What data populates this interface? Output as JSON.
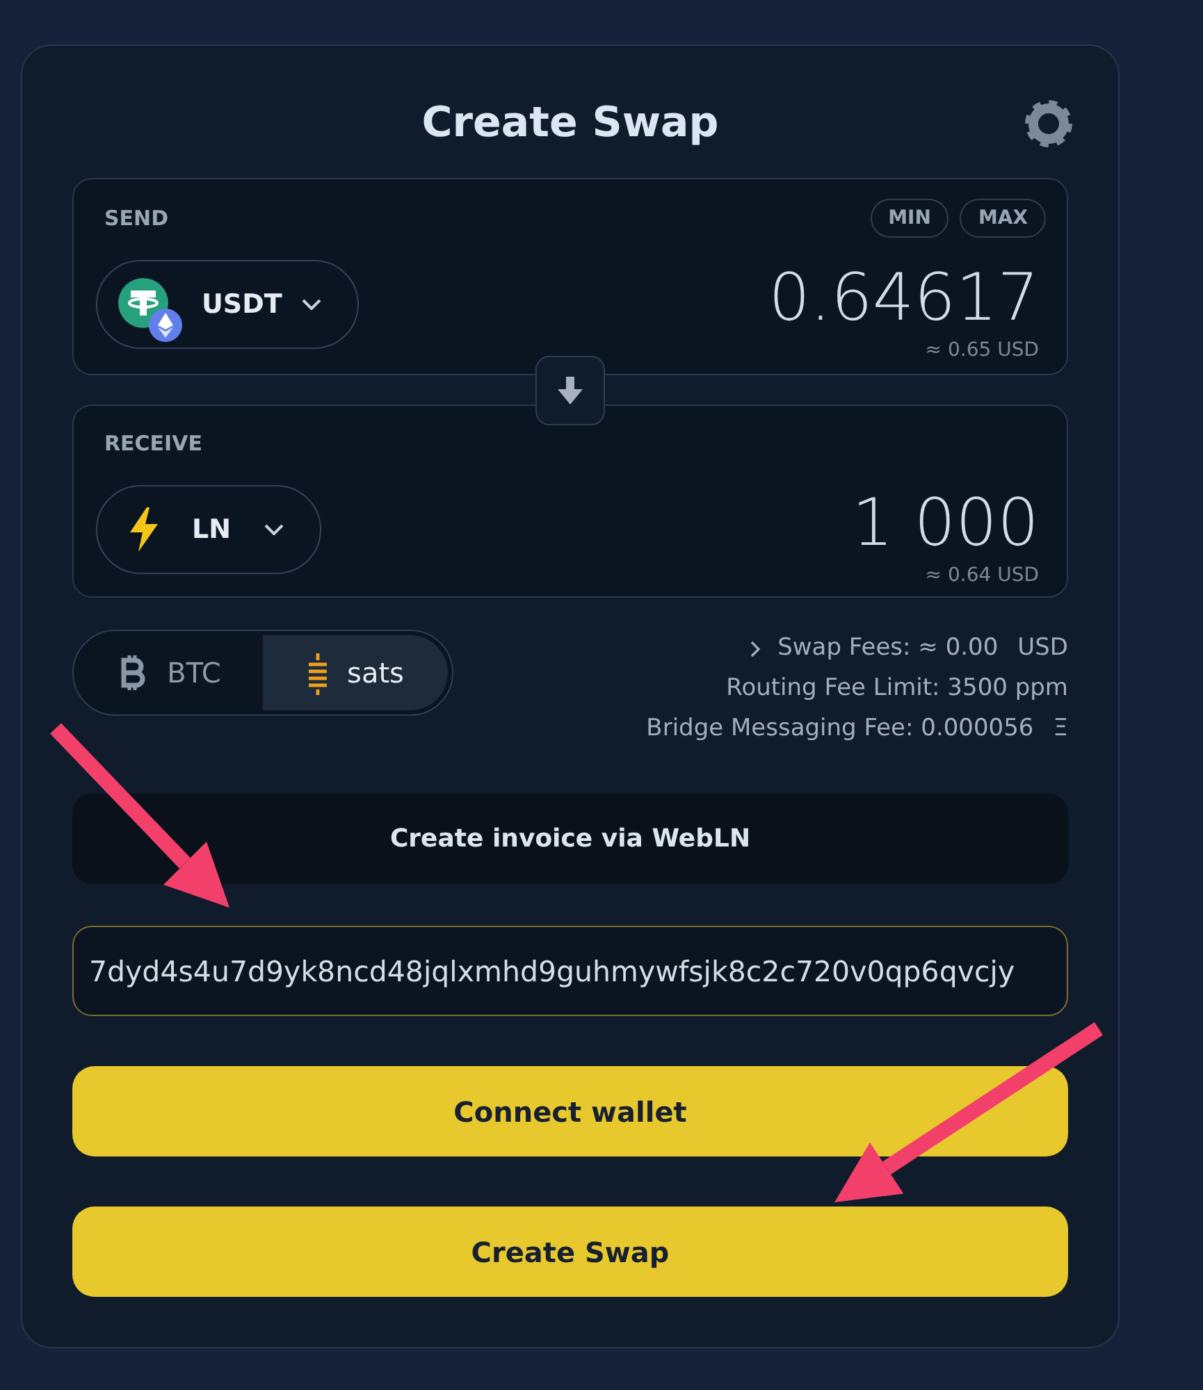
{
  "header": {
    "title": "Create Swap"
  },
  "send": {
    "label": "SEND",
    "quick_buttons": [
      "MIN",
      "MAX"
    ],
    "asset": {
      "kind": "tether",
      "symbol": "USDT",
      "network_badge": true
    },
    "amount": "0.64617",
    "fiat": "≈ 0.65 USD"
  },
  "receive": {
    "label": "RECEIVE",
    "asset": {
      "kind": "lightning",
      "symbol": "LN",
      "network_badge": false
    },
    "amount": "1 000",
    "fiat": "≈ 0.64 USD"
  },
  "denomination": [
    {
      "kind": "btc",
      "label": "BTC",
      "selected": false
    },
    {
      "kind": "sats",
      "label": "sats",
      "selected": true
    }
  ],
  "fees": {
    "expanded": false,
    "lines": [
      {
        "text": "Swap Fees: ≈ 0.00",
        "unit": "USD"
      },
      {
        "text": "Routing Fee Limit: 3500 ppm"
      },
      {
        "text": "Bridge Messaging Fee: 0.000056",
        "unit": "Ξ"
      }
    ]
  },
  "webln_button": "Create invoice via WebLN",
  "invoice": {
    "value": "7dyd4s4u7d9yk8ncd48jqlxmhd9guhmywfsjk8c2c720v0qp6qvcjy"
  },
  "buttons": [
    "Connect wallet",
    "Create Swap"
  ],
  "annotations": [
    {
      "kind": "arrow"
    },
    {
      "kind": "arrow"
    }
  ]
}
